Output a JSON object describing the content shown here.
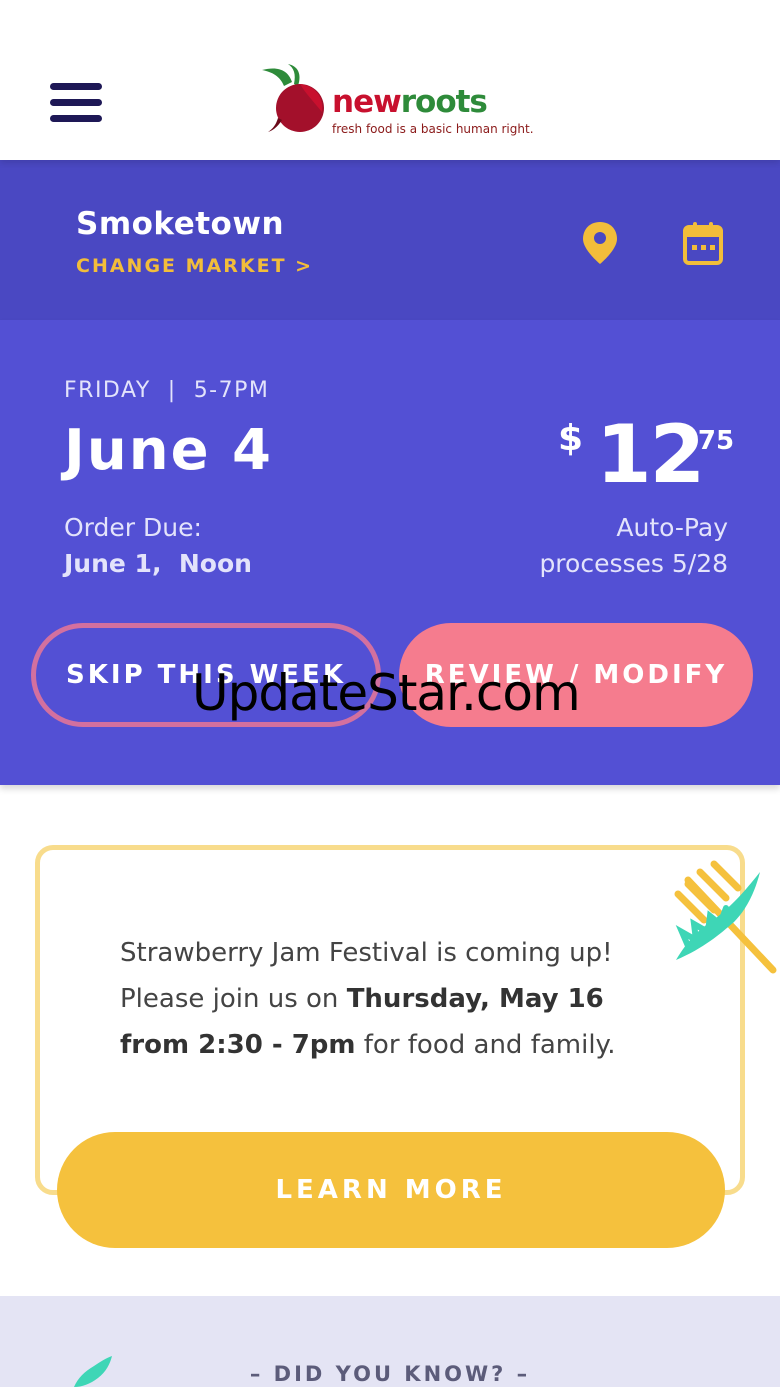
{
  "header": {
    "menu_icon": "hamburger-menu-icon",
    "logo": {
      "word_part1": "new",
      "word_part2": "roots",
      "tagline": "fresh food is a basic human right."
    }
  },
  "market": {
    "name": "Smoketown",
    "change_label": "CHANGE MARKET >",
    "location_icon": "map-pin-icon",
    "calendar_icon": "calendar-icon"
  },
  "order": {
    "day": "FRIDAY",
    "separator": "|",
    "time": "5-7PM",
    "date": "June 4",
    "due_label": "Order Due:",
    "due_value": "June 1,  Noon",
    "price": {
      "currency": "$",
      "dollars": "12",
      "cents": ".75"
    },
    "autopay_label": "Auto-Pay",
    "autopay_value": "processes 5/28",
    "skip_label": "SKIP THIS WEEK",
    "review_label": "REVIEW / MODIFY"
  },
  "watermark": "UpdateStar.com",
  "event": {
    "line1": "Strawberry Jam Festival is coming up!",
    "line2_prefix": "Please join us on ",
    "line2_bold": "Thursday, May 16",
    "line3_bold": "from 2:30 - 7pm",
    "line3_suffix": " for food and family.",
    "button_label": "LEARN MORE",
    "deco_icon": "fork-with-greens-icon"
  },
  "did_you_know": {
    "title": "DID YOU KNOW?",
    "dash": "–",
    "deco_icon": "leaf-icon"
  },
  "colors": {
    "navy": "#1e1856",
    "market_bg": "#4a48c2",
    "order_bg": "#5350d4",
    "accent_yellow": "#f2bd3a",
    "pink_outline": "#d3709f",
    "pink_button": "#f57c8e",
    "button_yellow": "#f5c13d",
    "card_border": "#f8dc8c",
    "logo_red": "#c8102e",
    "logo_green": "#2e8b3a"
  }
}
